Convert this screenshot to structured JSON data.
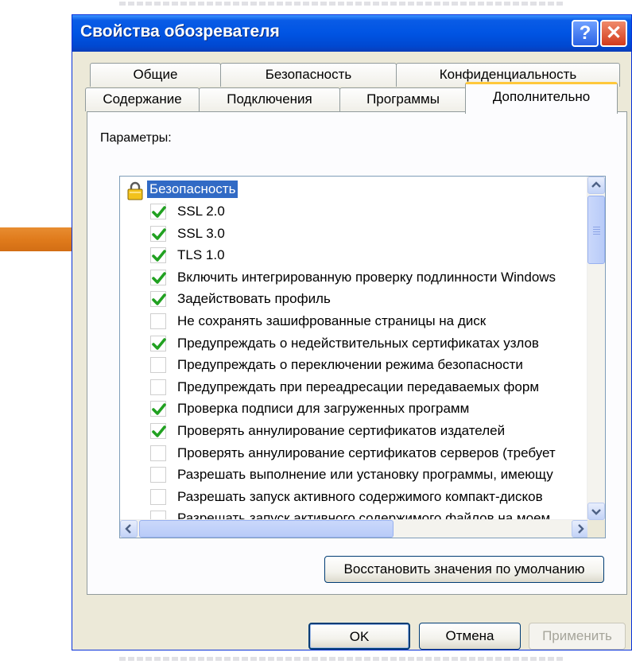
{
  "window": {
    "title": "Свойства обозревателя",
    "help_glyph": "?",
    "close_glyph": "✕"
  },
  "tabs": {
    "row_back": [
      "Общие",
      "Безопасность",
      "Конфиденциальность"
    ],
    "row_front": [
      "Содержание",
      "Подключения",
      "Программы",
      "Дополнительно"
    ],
    "active": "Дополнительно"
  },
  "settings": {
    "label": "Параметры:",
    "category": "Безопасность",
    "items": [
      {
        "label": "SSL 2.0",
        "checked": true
      },
      {
        "label": "SSL 3.0",
        "checked": true
      },
      {
        "label": "TLS 1.0",
        "checked": true
      },
      {
        "label": "Включить интегрированную проверку подлинности Windows",
        "checked": true
      },
      {
        "label": "Задействовать профиль",
        "checked": true
      },
      {
        "label": "Не сохранять зашифрованные страницы на диск",
        "checked": false
      },
      {
        "label": "Предупреждать о недействительных сертификатах узлов",
        "checked": true
      },
      {
        "label": "Предупреждать о переключении режима безопасности",
        "checked": false
      },
      {
        "label": "Предупреждать при переадресации передаваемых форм",
        "checked": false
      },
      {
        "label": "Проверка подписи для загруженных программ",
        "checked": true
      },
      {
        "label": "Проверять аннулирование сертификатов издателей",
        "checked": true
      },
      {
        "label": "Проверять аннулирование сертификатов серверов (требует",
        "checked": false
      },
      {
        "label": "Разрешать выполнение или установку программы, имеющу",
        "checked": false
      },
      {
        "label": "Разрешать запуск активного содержимого компакт-дисков",
        "checked": false
      },
      {
        "label": "Разрешать запуск активного содержимого файлов на моем",
        "checked": false
      }
    ]
  },
  "buttons": {
    "restore": "Восстановить значения по умолчанию",
    "ok": "OK",
    "cancel": "Отмена",
    "apply": "Применить"
  },
  "colors": {
    "arrow": "#e07b1c",
    "title_bar": "#0054e3",
    "check": "#21a121",
    "selection": "#316ac5"
  }
}
